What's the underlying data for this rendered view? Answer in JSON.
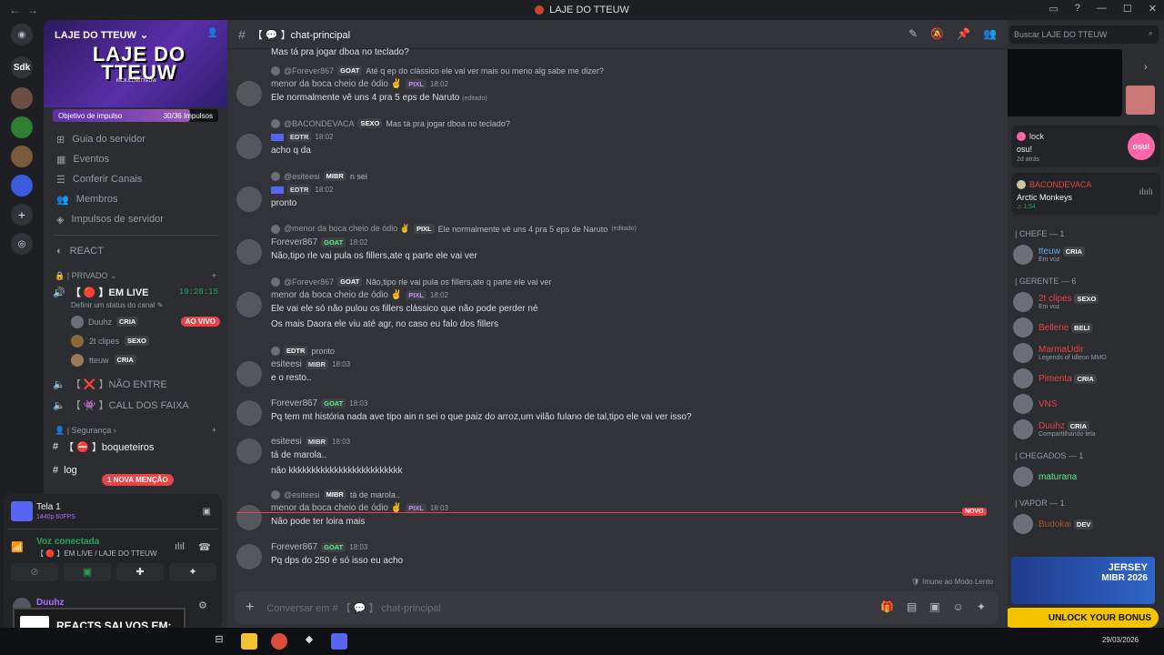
{
  "window": {
    "title": "LAJE DO TTEUW"
  },
  "guilds": [
    {
      "name": "discord-home",
      "label": ""
    },
    {
      "name": "server-sdk",
      "label": "Sdk"
    }
  ],
  "server": {
    "name": "LAJE DO TTEUW",
    "banner_text": "LAJE DO TTEUW",
    "banner_url": "KICK.COM/TTEUW",
    "boost_label": "Objetivo de impulso",
    "boost_count": "30/36 Impulsos",
    "boost_progress": 0.83
  },
  "sidebar": {
    "menu": [
      "Guia do servidor",
      "Eventos",
      "Conferir Canais",
      "Membros",
      "Impulsos de servidor"
    ],
    "react": "REACT",
    "private_cat": "PRIVADO",
    "live_channel": "【 🔴 】EM LIVE",
    "live_timer": "19:28:15",
    "live_status": "Definir um status do canal",
    "voice_users": [
      {
        "name": "Duuhz",
        "tag": "CRIA",
        "live": "AO VIVO"
      },
      {
        "name": "2t clipes",
        "tag": "SEXO",
        "live": ""
      },
      {
        "name": "tteuw",
        "tag": "CRIA",
        "live": ""
      }
    ],
    "other_voice": [
      "【 ❌ 】NÃO ENTRE",
      "【 👾 】CALL DOS FAIXA"
    ],
    "security_cat": "Segurança",
    "text_channels": [
      "【 ⛔ 】boqueteiros",
      "log"
    ],
    "mention_badge": "1 NOVA MENÇÃO"
  },
  "userpanel": {
    "stream_title": "Tela 1",
    "stream_quality": "1440p 60FPS",
    "voice_status": "Voz conectada",
    "voice_channel": "【 🔴 】EM LIVE / LAJE DO TTEUW",
    "username": "Duuhz"
  },
  "overlay": {
    "reacts": "REACTS SALVOS EM:"
  },
  "channel": {
    "name": "chat-principal",
    "composer_placeholder": "Conversar em #",
    "composer_channel": "chat-principal"
  },
  "messages": [
    {
      "top_line": "Mas tá pra jogar dboa no teclado?"
    },
    {
      "reply_name": "@Forever867",
      "reply_tag": "GOAT",
      "reply_text": "Até q ep do clássico ele vai ver mais ou meno alg sabe me dizer?",
      "author": "menor da boca cheio de ódio ✌",
      "tag": "PIXL",
      "time": "18:02",
      "lines": [
        "Ele normalmente vê uns 4 pra 5 eps de Naruto"
      ],
      "edited": "(editado)"
    },
    {
      "reply_name": "@BACONDEVACA",
      "reply_tag": "SEXO",
      "reply_text": "Mas tá pra jogar dboa no teclado?",
      "author": "",
      "tag": "EDTR",
      "time": "18:02",
      "lines": [
        "acho q da"
      ]
    },
    {
      "reply_name": "@esiteesi",
      "reply_tag": "MIBR",
      "reply_text": "n sei",
      "author": "",
      "tag": "EDTR",
      "time": "18:02",
      "lines": [
        "pronto"
      ]
    },
    {
      "reply_name": "@menor da boca cheio de ódio ✌",
      "reply_tag": "PIXL",
      "reply_text": "Ele normalmente vê uns 4 pra 5 eps de Naruto",
      "reply_edited": "(editado)",
      "author": "Forever867",
      "tag": "GOAT",
      "time": "18:02",
      "lines": [
        "Não,tipo rle vai pula os fillers,ate q parte ele vai ver"
      ]
    },
    {
      "reply_name": "@Forever867",
      "reply_tag": "GOAT",
      "reply_text": "Não,tipo rle vai pula os fillers,ate q parte ele vai ver",
      "author": "menor da boca cheio de ódio ✌",
      "tag": "PIXL",
      "time": "18:02",
      "lines": [
        "Ele vai ele só não pulou os fillers clássico que não pode perder né",
        "Os mais Daora ele viu até agr, no caso eu falo dos fillers"
      ]
    },
    {
      "reply_name": "",
      "reply_tag": "EDTR",
      "reply_text": "pronto",
      "author": "esiteesi",
      "tag": "MIBR",
      "time": "18:03",
      "lines": [
        "e o resto.."
      ]
    },
    {
      "author": "Forever867",
      "tag": "GOAT",
      "time": "18:03",
      "lines": [
        "Pq tem mt história nada ave tipo ain n sei o que paiz do arroz,um vilão fulano de tal,tipo ele vai ver isso?"
      ]
    },
    {
      "author": "esiteesi",
      "tag": "MIBR",
      "time": "18:03",
      "lines": [
        "tá de marola..",
        "não kkkkkkkkkkkkkkkkkkkkkkkkk"
      ]
    },
    {
      "reply_name": "@esiteesi",
      "reply_tag": "MIBR",
      "reply_text": "tá de marola..",
      "author": "menor da boca cheio de ódio ✌",
      "tag": "PIXL",
      "time": "18:03",
      "lines": [
        "Não pode ter loira mais"
      ]
    },
    {
      "author": "Forever867",
      "tag": "GOAT",
      "time": "18:03",
      "lines": [
        "Pq dps do 250 é só isso eu acho"
      ]
    }
  ],
  "new_tag": "NOVO",
  "slow_mode": "Imune ao Modo Lento",
  "members": {
    "search_placeholder": "Buscar LAJE DO TTEUW",
    "activity": {
      "name": "lock",
      "game": "osu!",
      "time": "2d atrás",
      "logo": "osu!"
    },
    "music": {
      "name": "BACONDEVACA",
      "song": "Arctic Monkeys",
      "duration": "1:54"
    },
    "groups": [
      {
        "title": "| CHEFE — 1",
        "items": [
          {
            "name": "tteuw",
            "tag": "CRIA",
            "sub": "Em voz",
            "color": "#5dadec"
          }
        ]
      },
      {
        "title": "| GERENTE — 6",
        "items": [
          {
            "name": "2t clipes",
            "tag": "SEXO",
            "sub": "Em voz",
            "color": "#ed4245"
          },
          {
            "name": "Bellene",
            "tag": "BELI",
            "sub": "",
            "color": "#ed4245"
          },
          {
            "name": "MarmaUdir",
            "tag": "",
            "sub": "Legends of Idleon MMO",
            "color": "#ed4245"
          },
          {
            "name": "Pimenta",
            "tag": "CRIA",
            "sub": "",
            "color": "#ed4245"
          },
          {
            "name": "VNS",
            "tag": "",
            "sub": "",
            "color": "#ed4245"
          },
          {
            "name": "Duuhz",
            "tag": "CRIA",
            "sub": "Compartilhando tela",
            "color": "#ed4245"
          }
        ]
      },
      {
        "title": "| CHEGADOS — 1",
        "items": [
          {
            "name": "maturana",
            "tag": "",
            "sub": "",
            "color": "#57f287"
          }
        ]
      },
      {
        "title": "| VAPOR — 1",
        "items": [
          {
            "name": "Budokai",
            "tag": "DEV",
            "sub": "",
            "color": "#a0522d"
          }
        ]
      }
    ],
    "promo": {
      "line1": "JERSEY",
      "line2": "MIBR 2026"
    },
    "unlock": "UNLOCK YOUR BONUS"
  },
  "taskbar": {
    "date": "29/03/2026"
  }
}
